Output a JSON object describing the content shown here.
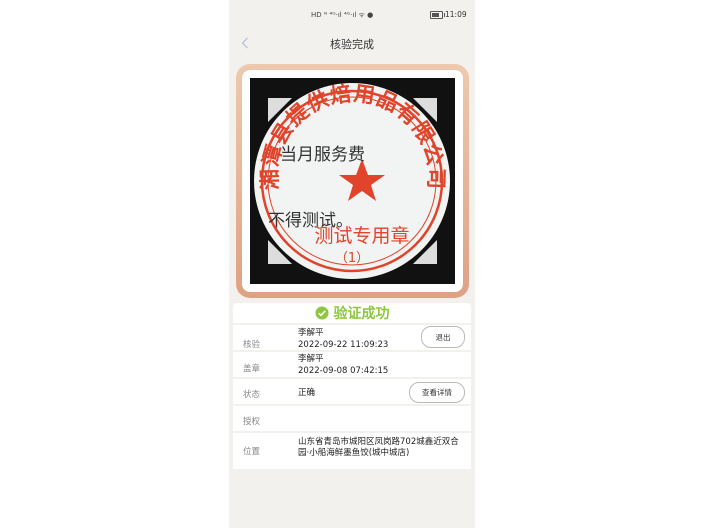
{
  "status_bar": {
    "time": "11:09",
    "left_icons": "HD ᴺ ⁴ᴳ·ıl ⁴ᴳ·ıl ᯤ ●"
  },
  "nav": {
    "title": "核验完成"
  },
  "seal_image": {
    "ring_text": "湘潭县提供焙用品有限公司",
    "line1": "当月服务费",
    "line2": "不得测试。",
    "bottom_text": "测试专用章",
    "number": "（1）",
    "colors": {
      "stamp": "#e0452c",
      "background": "#111111"
    }
  },
  "result": {
    "title": "验证成功",
    "color": "#8dc63f"
  },
  "rows": {
    "verify": {
      "label": "核验",
      "name": "李解平",
      "time": "2022-09-22 11:09:23",
      "button": "退出"
    },
    "stamp": {
      "label": "盖章",
      "name": "李解平",
      "time": "2022-09-08 07:42:15"
    },
    "state": {
      "label": "状态",
      "value": "正确",
      "button": "查看详情"
    },
    "auth": {
      "label": "授权",
      "value": ""
    },
    "location": {
      "label": "位置",
      "value": "山东省青岛市城阳区凤岗路702城鑫近双合园·小船海鲜墨鱼饺(城中城店)"
    }
  }
}
